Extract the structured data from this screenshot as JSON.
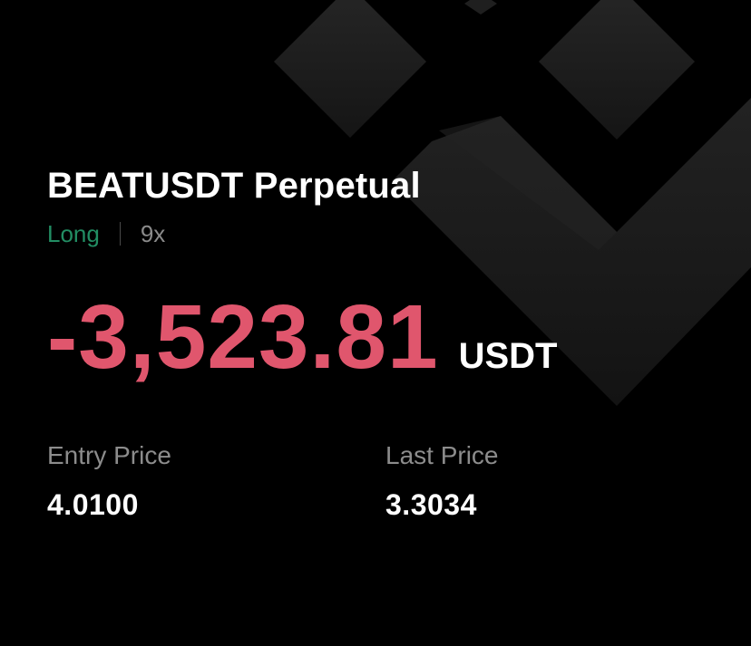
{
  "position": {
    "symbol": "BEATUSDT Perpetual",
    "side": "Long",
    "leverage": "9x"
  },
  "pnl": {
    "value": "-3,523.81",
    "unit": "USDT"
  },
  "stats": {
    "entry_label": "Entry Price",
    "entry_value": "4.0100",
    "last_label": "Last Price",
    "last_value": "3.3034"
  },
  "colors": {
    "background": "#000000",
    "negative_pnl": "#e0566d",
    "long": "#2ebd85",
    "muted_text": "#8c8c8c",
    "primary_text": "#ffffff",
    "logo_shape": "#1c1c1c"
  },
  "icons": {
    "background": "exchange-logo-watermark"
  }
}
